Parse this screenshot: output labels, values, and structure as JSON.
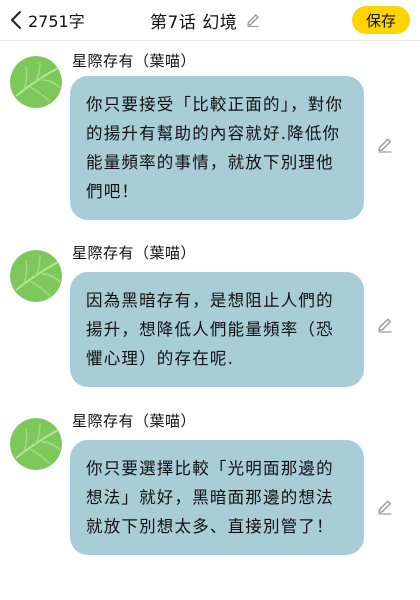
{
  "header": {
    "word_count": "2751字",
    "title": "第7话 幻境",
    "save_label": "保存"
  },
  "messages": [
    {
      "sender": "星際存有（葉喵）",
      "text": "你只要接受「比較正面的」，對你的揚升有幫助的內容就好.降低你能量頻率的事情，就放下別理他們吧！"
    },
    {
      "sender": "星際存有（葉喵）",
      "text": "因為黑暗存有，是想阻止人們的揚升，想降低人們能量頻率（恐懼心理）的存在呢."
    },
    {
      "sender": "星際存有（葉喵）",
      "text": "你只要選擇比較「光明面那邊的想法」就好，黑暗面那邊的想法就放下別想太多、直接別管了！"
    }
  ],
  "colors": {
    "bubble": "#a8cdd7",
    "save_button": "#ffd400",
    "avatar": "#7cc85a"
  },
  "icons": {
    "back": "chevron-left-icon",
    "edit": "pencil-icon"
  }
}
